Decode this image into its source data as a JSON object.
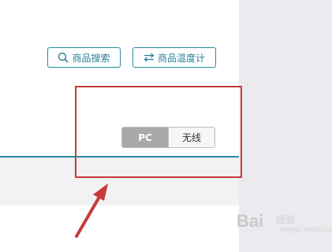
{
  "toolbar": {
    "search_label": "商品搜索",
    "temperature_label": "商品温度计"
  },
  "device_toggle": {
    "pc_label": "PC",
    "wireless_label": "无线",
    "selected": "PC"
  },
  "watermark": {
    "brand": "Bai",
    "sub": "经验",
    "url": "jingyan.baidu.com"
  },
  "colors": {
    "accent": "#2a8aa0",
    "highlight_box": "#c73a3a",
    "arrow": "#c73a3a",
    "toggle_selected": "#a8a8aa"
  },
  "icons": {
    "search": "search-icon",
    "swap": "swap-arrows-icon",
    "annotation_arrow": "red-arrow-icon"
  }
}
